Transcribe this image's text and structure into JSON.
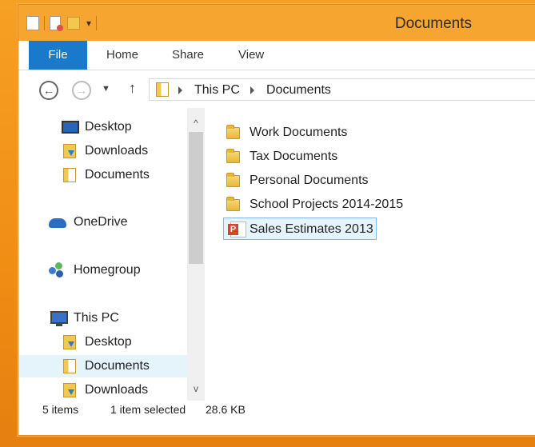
{
  "window": {
    "title": "Documents"
  },
  "ribbon": {
    "tabs": [
      "File",
      "Home",
      "Share",
      "View"
    ]
  },
  "address": {
    "crumbs": [
      "This PC",
      "Documents"
    ]
  },
  "nav": {
    "quick_access": [
      "Desktop",
      "Downloads",
      "Documents"
    ],
    "onedrive": "OneDrive",
    "homegroup": "Homegroup",
    "this_pc": "This PC",
    "this_pc_items": [
      "Desktop",
      "Documents",
      "Downloads"
    ]
  },
  "files": [
    {
      "name": "Work Documents",
      "type": "folder"
    },
    {
      "name": "Tax Documents",
      "type": "folder"
    },
    {
      "name": "Personal Documents",
      "type": "folder"
    },
    {
      "name": "School Projects 2014-2015",
      "type": "folder"
    },
    {
      "name": "Sales Estimates 2013",
      "type": "powerpoint",
      "selected": true
    }
  ],
  "status": {
    "items": "5 items",
    "selection": "1 item selected",
    "size": "28.6 KB"
  },
  "colors": {
    "accent": "#1979ca",
    "titlebar": "#f6a530",
    "selection": "#e5f3fb"
  }
}
